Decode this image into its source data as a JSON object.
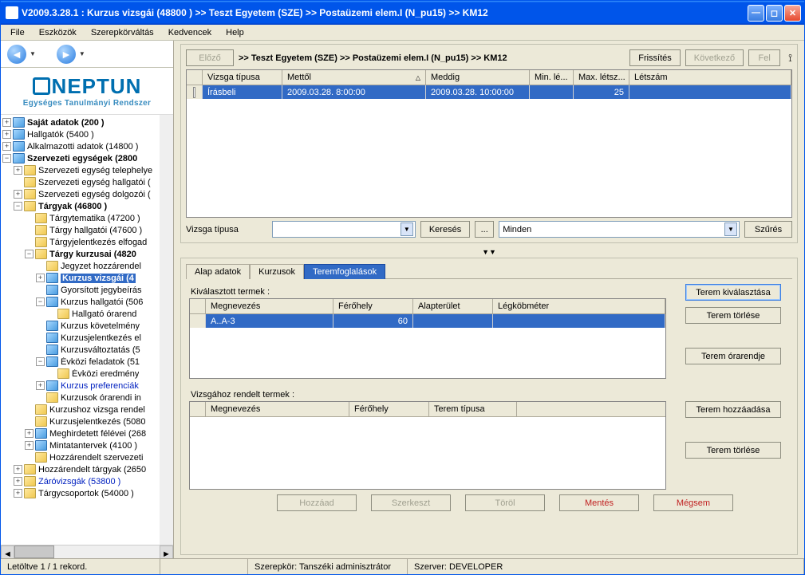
{
  "titlebar": "V2009.3.28.1 : Kurzus vizsgái (48800  )   >> Teszt Egyetem (SZE) >> Postaüzemi elem.I (N_pu15) >> KM12",
  "menu": {
    "file": "File",
    "tools": "Eszközök",
    "roleswitch": "Szerepkörváltás",
    "favorites": "Kedvencek",
    "help": "Help"
  },
  "logo": {
    "main": "NEPTUN",
    "sub": "Egységes Tanulmányi Rendszer"
  },
  "tree": {
    "n0": "Saját adatok (200  )",
    "n1": "Hallgatók (5400  )",
    "n2": "Alkalmazotti adatok (14800  )",
    "n3": "Szervezeti egységek (2800",
    "n3a": "Szervezeti egység telephelye",
    "n3b": "Szervezeti egység hallgatói (",
    "n3c": "Szervezeti egység dolgozói (",
    "n3d": "Tárgyak (46800  )",
    "n3d1": "Tárgytematika (47200  )",
    "n3d2": "Tárgy hallgatói (47600  )",
    "n3d3": "Tárgyjelentkezés elfogad",
    "n3d4": "Tárgy kurzusai (4820",
    "n3d4a": "Jegyzet hozzárendel",
    "n3d4b": "Kurzus vizsgái (4",
    "n3d4c": "Gyorsított jegybeírás",
    "n3d4d": "Kurzus hallgatói (506",
    "n3d4d1": "Hallgató órarend",
    "n3d4e": "Kurzus követelmény",
    "n3d4f": "Kurzusjelentkezés el",
    "n3d4g": "Kurzusváltoztatás (5",
    "n3d4h": "Évközi feladatok (51",
    "n3d4h1": "Évközi eredmény",
    "n3d4i": "Kurzus preferenciák",
    "n3d4j": "Kurzusok órarendi in",
    "n3d5": "Kurzushoz vizsga rendel",
    "n3d6": "Kurzusjelentkezés (5080",
    "n3d7": "Meghirdetett félévei (268",
    "n3d8": "Mintatantervek (4100  )",
    "n3d9": "Hozzárendelt szervezeti",
    "n3e": "Hozzárendelt tárgyak (2650",
    "n3f": "Záróvizsgák (53800  )",
    "n3g": "Tárgycsoportok (54000  )"
  },
  "breadcrumb": ">>  Teszt Egyetem (SZE) >> Postaüzemi elem.I (N_pu15) >> KM12",
  "navbtns": {
    "prev": "Előző",
    "refresh": "Frissítés",
    "next": "Következő",
    "up": "Fel"
  },
  "grid1": {
    "headers": {
      "chk": "",
      "tipus": "Vizsga típusa",
      "mettol": "Mettől",
      "meddig": "Meddig",
      "minle": "Min. lé...",
      "maxletsz": "Max. létsz...",
      "letszam": "Létszám"
    },
    "row": {
      "tipus": "Írásbeli",
      "mettol": "2009.03.28. 8:00:00",
      "meddig": "2009.03.28. 10:00:00",
      "minle": "",
      "maxletsz": "25",
      "letszam": ""
    }
  },
  "filter": {
    "label": "Vizsga típusa",
    "search": "Keresés",
    "all": "Minden",
    "filterbtn": "Szűrés"
  },
  "tabs": {
    "t1": "Alap adatok",
    "t2": "Kurzusok",
    "t3": "Teremfoglalások"
  },
  "sec1": "Kiválasztott termek :",
  "grid2": {
    "headers": {
      "megn": "Megnevezés",
      "fero": "Férőhely",
      "alap": "Alapterület",
      "legk": "Légköbméter"
    },
    "row": {
      "megn": "A..A-3",
      "fero": "60",
      "alap": "",
      "legk": ""
    }
  },
  "rbtns": {
    "b1": "Terem kiválasztása",
    "b2": "Terem törlése",
    "b3": "Terem órarendje",
    "b4": "Terem hozzáadása",
    "b5": "Terem törlése"
  },
  "sec2": "Vizsgához rendelt termek :",
  "grid3": {
    "headers": {
      "megn": "Megnevezés",
      "fero": "Férőhely",
      "tipus": "Terem típusa"
    }
  },
  "bbtns": {
    "add": "Hozzáad",
    "edit": "Szerkeszt",
    "del": "Töröl",
    "save": "Mentés",
    "cancel": "Mégsem"
  },
  "status": {
    "records": "Letöltve 1 / 1 rekord.",
    "role": "Szerepkör: Tanszéki adminisztrátor",
    "server": "Szerver: DEVELOPER"
  }
}
